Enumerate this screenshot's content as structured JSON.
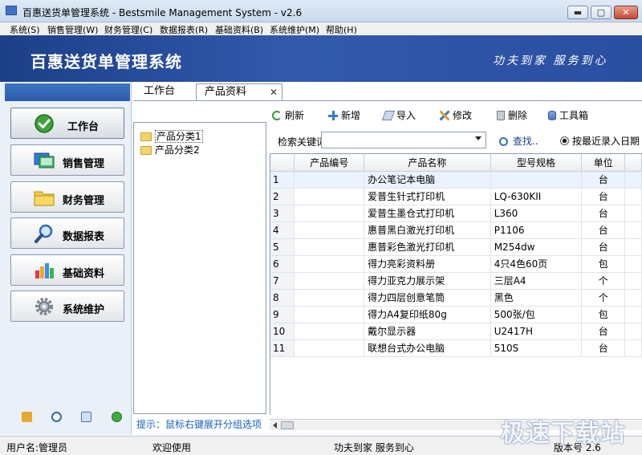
{
  "window": {
    "title": "百惠送货单管理系统 - Bestsmile Management System - v2.6",
    "minimize_glyph": "▬",
    "maximize_glyph": "▢",
    "close_glyph": "✕"
  },
  "menu": {
    "items": [
      "系统(S)",
      "销售管理(W)",
      "财务管理(C)",
      "数据报表(R)",
      "基础资料(B)",
      "系统维护(M)",
      "帮助(H)"
    ]
  },
  "banner": {
    "title": "百惠送货单管理系统",
    "slogan": "功夫到家 服务到心"
  },
  "sidebar": {
    "items": [
      {
        "label": "工作台",
        "icon": "check-circle-icon"
      },
      {
        "label": "销售管理",
        "icon": "monitor-icon"
      },
      {
        "label": "财务管理",
        "icon": "folder-icon"
      },
      {
        "label": "数据报表",
        "icon": "magnifier-icon"
      },
      {
        "label": "基础资料",
        "icon": "database-icon"
      },
      {
        "label": "系统维护",
        "icon": "gear-icon"
      }
    ],
    "bottom_icons": [
      "key-icon",
      "clock-icon",
      "monitor-search-icon",
      "refresh-icon"
    ]
  },
  "tabs": {
    "workbench": "工作台",
    "products": "产品资料",
    "close_glyph": "✕"
  },
  "toolbar": {
    "refresh": "刷新",
    "add": "新增",
    "import": "导入",
    "edit": "修改",
    "delete": "删除",
    "tools": "工具箱"
  },
  "tree": {
    "nodes": [
      "产品分类1",
      "产品分类2"
    ],
    "hint": "提示：鼠标右键展开分组选项"
  },
  "search": {
    "label": "检索关键词",
    "value": "",
    "button": "查找..",
    "radio": "按最近录入日期"
  },
  "table": {
    "headers": [
      "",
      "产品编号",
      "产品名称",
      "型号规格",
      "单位",
      ""
    ],
    "rows": [
      {
        "idx": "1",
        "code": "",
        "name": "办公笔记本电脑",
        "spec": "",
        "unit": "台"
      },
      {
        "idx": "2",
        "code": "",
        "name": "爱普生针式打印机",
        "spec": "LQ-630KII",
        "unit": "台"
      },
      {
        "idx": "3",
        "code": "",
        "name": "爱普生墨仓式打印机",
        "spec": "L360",
        "unit": "台"
      },
      {
        "idx": "4",
        "code": "",
        "name": "惠普黑白激光打印机",
        "spec": "P1106",
        "unit": "台"
      },
      {
        "idx": "5",
        "code": "",
        "name": "惠普彩色激光打印机",
        "spec": "M254dw",
        "unit": "台"
      },
      {
        "idx": "6",
        "code": "",
        "name": "得力亮彩资料册",
        "spec": "4只4色60页",
        "unit": "包"
      },
      {
        "idx": "7",
        "code": "",
        "name": "得力亚克力展示架",
        "spec": "三层A4",
        "unit": "个"
      },
      {
        "idx": "8",
        "code": "",
        "name": "得力四层创意笔筒",
        "spec": "黑色",
        "unit": "个"
      },
      {
        "idx": "9",
        "code": "",
        "name": "得力A4复印纸80g",
        "spec": "500张/包",
        "unit": "包"
      },
      {
        "idx": "10",
        "code": "",
        "name": "戴尔显示器",
        "spec": "U2417H",
        "unit": "台"
      },
      {
        "idx": "11",
        "code": "",
        "name": "联想台式办公电脑",
        "spec": "510S",
        "unit": "台"
      }
    ]
  },
  "status": {
    "user": "用户名:管理员",
    "welcome": "欢迎使用",
    "slogan": "功夫到家 服务到心",
    "version": "版本号 2.6"
  },
  "watermark": "极速下载站",
  "colors": {
    "banner": "#2b4fa0",
    "accent": "#1a5fbe"
  }
}
